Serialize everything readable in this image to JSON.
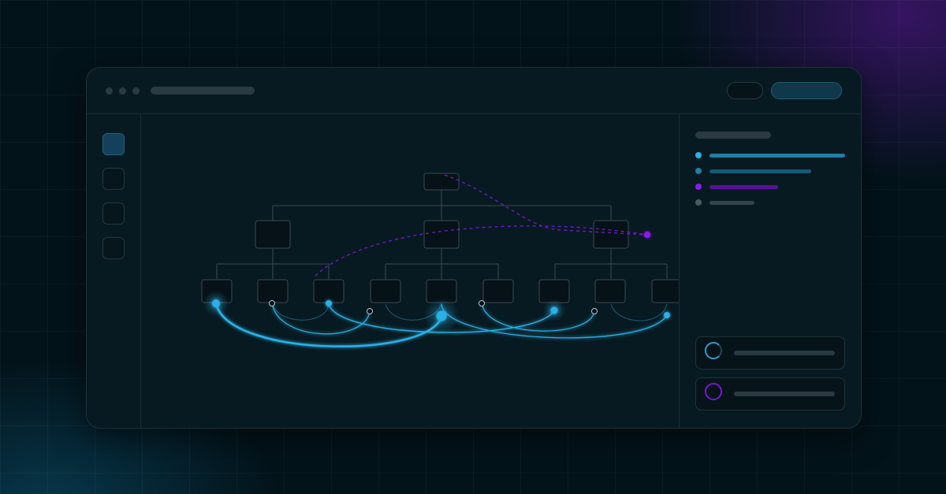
{
  "window": {
    "title_placeholder": "",
    "traffic_lights": [
      "dot",
      "dot",
      "dot"
    ]
  },
  "toolbar": {
    "secondary_button": "",
    "primary_button": ""
  },
  "sidebar": {
    "items": [
      {
        "icon": "nav-item-1",
        "active": true
      },
      {
        "icon": "nav-item-2",
        "active": false
      },
      {
        "icon": "nav-item-3",
        "active": false
      },
      {
        "icon": "nav-item-4",
        "active": false
      }
    ]
  },
  "diagram": {
    "root": "root-node",
    "level1": [
      "node-a",
      "node-b",
      "node-c"
    ],
    "level2": [
      "leaf-1",
      "leaf-2",
      "leaf-3",
      "leaf-4",
      "leaf-5",
      "leaf-6",
      "leaf-7",
      "leaf-8",
      "leaf-9"
    ]
  },
  "right_panel": {
    "legend": [
      {
        "color": "#2bb0e6"
      },
      {
        "color": "#1f7fa8"
      },
      {
        "color": "#7a14d6"
      },
      {
        "color": "#4b585e"
      }
    ],
    "cards": [
      {
        "ring_color": "#2a9fd0"
      },
      {
        "ring_color": "#7a14d6"
      }
    ]
  },
  "colors": {
    "accent_blue": "#2bb0e6",
    "accent_purple": "#8a1cf0",
    "background": "#03131a",
    "panel": "#081a21"
  }
}
